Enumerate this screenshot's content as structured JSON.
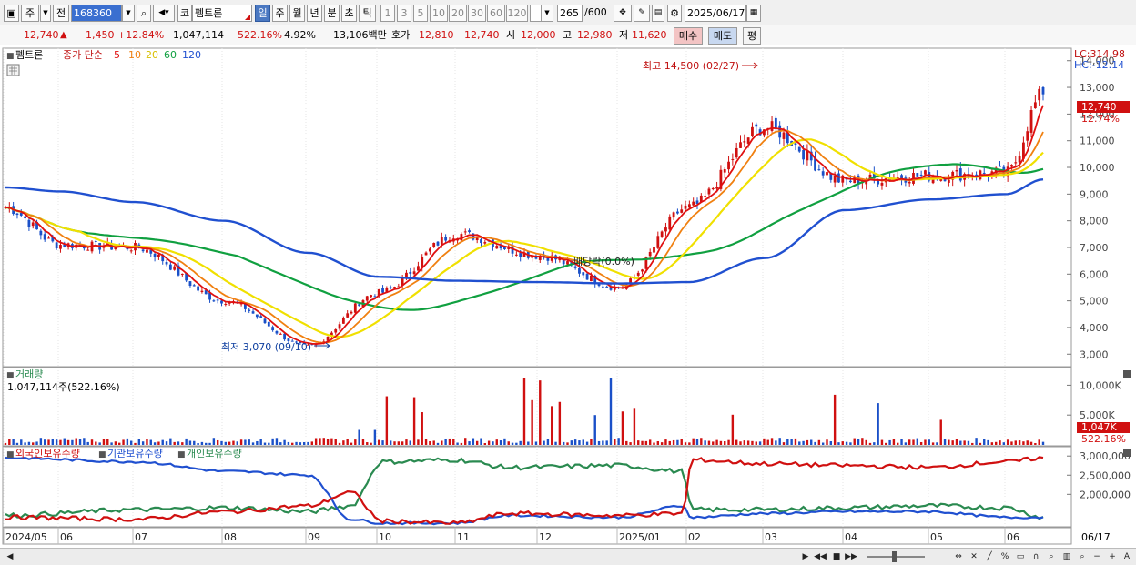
{
  "toolbar": {
    "market": "주",
    "prev_label": "전",
    "code": "168360",
    "name": "펨트론",
    "name_prefix": "코",
    "periods": [
      "일",
      "주",
      "월",
      "년",
      "분",
      "초",
      "틱"
    ],
    "multipliers": [
      "1",
      "3",
      "5",
      "10",
      "20",
      "30",
      "60",
      "120"
    ],
    "count": "265",
    "total": "/600",
    "date": "2025/06/17"
  },
  "quote": {
    "price": "12,740",
    "change": "1,450",
    "change_pct": "+12.84%",
    "volume": "1,047,114",
    "vol_ratio": "522.16%",
    "turnover": "4.92%",
    "amount": "13,106백만",
    "hoga_label": "호가",
    "hoga_ask": "12,810",
    "hoga_bid": "12,740",
    "open_label": "시",
    "open": "12,000",
    "high_label": "고",
    "high": "12,980",
    "low_label": "저",
    "low": "11,620",
    "buy_label": "매수",
    "sell_label": "매도",
    "eval_label": "평"
  },
  "legend": {
    "name": "펨트론",
    "line_type": "종가 단순",
    "ma": [
      {
        "period": "5",
        "color": "#e01010"
      },
      {
        "period": "10",
        "color": "#f08010"
      },
      {
        "period": "20",
        "color": "#e8d000"
      },
      {
        "period": "60",
        "color": "#10a040"
      },
      {
        "period": "120",
        "color": "#2050d0"
      }
    ]
  },
  "annotations": {
    "high": "최고 14,500 (02/27)",
    "low": "최저 3,070 (09/10)",
    "dividend": "배당락(0.0%)"
  },
  "right_info": {
    "lc": "LC:314.98",
    "hc": "HC:-12.14",
    "price_tag": "12,740",
    "pct_tag": "12.74%",
    "vol_tag": "1,047K",
    "vol_pct_tag": "522.16%"
  },
  "volume_panel": {
    "title": "거래량",
    "info": "1,047,114주(522.16%)"
  },
  "holdings_panel": {
    "series": [
      {
        "name": "외국인보유수량",
        "color": "#d01010"
      },
      {
        "name": "기관보유수량",
        "color": "#2050d0"
      },
      {
        "name": "개인보유수량",
        "color": "#2a8a50"
      }
    ]
  },
  "axes": {
    "price_ticks": [
      "14,000",
      "13,000",
      "12,000",
      "11,000",
      "10,000",
      "9,000",
      "8,000",
      "7,000",
      "6,000",
      "5,000",
      "4,000",
      "3,000"
    ],
    "volume_ticks": [
      "10,000K",
      "5,000K"
    ],
    "holdings_ticks": [
      "3,000,000",
      "2,500,000",
      "2,000,000"
    ],
    "month_labels": [
      "2024/05",
      "06",
      "07",
      "08",
      "09",
      "10",
      "11",
      "12",
      "2025/01",
      "02",
      "03",
      "04",
      "05",
      "06"
    ],
    "end_date": "06/17"
  },
  "chart_data": {
    "type": "candlestick",
    "x": [
      "2024/05",
      "06",
      "07",
      "08",
      "09",
      "10",
      "11",
      "12",
      "2025/01",
      "02",
      "03",
      "04",
      "05",
      "06",
      "06/17"
    ],
    "series": [
      {
        "name": "종가",
        "values": [
          8500,
          7100,
          7000,
          5000,
          3300,
          5300,
          7500,
          6700,
          5500,
          8500,
          11500,
          9500,
          9700,
          9800,
          12740
        ]
      },
      {
        "name": "120",
        "values": [
          9250,
          9100,
          8700,
          8000,
          6800,
          5900,
          5750,
          5700,
          5650,
          5700,
          6600,
          8400,
          8800,
          9000,
          9550
        ]
      }
    ],
    "ylim": [
      2600,
      14400
    ],
    "annotations": [
      {
        "label": "최고",
        "value": 14500,
        "date": "02/27"
      },
      {
        "label": "최저",
        "value": 3070,
        "date": "09/10"
      }
    ]
  }
}
